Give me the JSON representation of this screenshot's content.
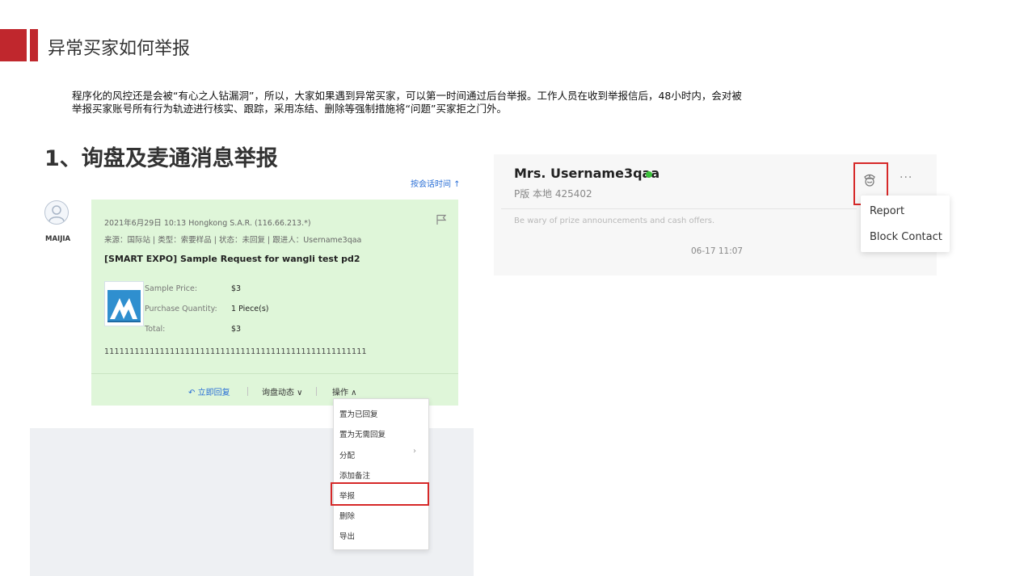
{
  "slide": {
    "title": "异常买家如何举报",
    "intro_line1": "程序化的风控还是会被“有心之人钻漏洞”，所以，大家如果遇到异常买家，可以第一时间通过后台举报。工作人员在收到举报信后，48小时内，会对被",
    "intro_line2": "举报买家账号所有行为轨迹进行核实、跟踪，采用冻结、删除等强制措施将“问题”买家拒之门外。",
    "section_title": "1、询盘及麦通消息举报",
    "accent_color": "#c0272d"
  },
  "inquiry": {
    "sort_label": "按会话时间 ↑",
    "buyer_name": "MAIJIA",
    "meta_line1": "2021年6月29日 10:13   Hongkong S.A.R. (116.66.213.*)",
    "meta_line2": "来源：国际站  |  类型：索要样品  |  状态：未回复  |  跟进人：Username3qaa",
    "subject": "[SMART EXPO] Sample Request for wangli test pd2",
    "product": {
      "rows": [
        {
          "label": "Sample Price:",
          "value": "$3"
        },
        {
          "label": "Purchase Quantity:",
          "value": "1 Piece(s)"
        },
        {
          "label": "Total:",
          "value": "$3"
        }
      ]
    },
    "message": "1111111111111111111111111111111111111111111111111111",
    "actions": {
      "reply": "立即回复",
      "dynamics": "询盘动态 ∨",
      "operate": "操作 ∧"
    },
    "menu_items": [
      "置为已回复",
      "置为无需回复",
      "分配",
      "添加备注",
      "举报",
      "删除",
      "导出"
    ],
    "highlight_color": "#d62828",
    "card_color": "#dff6d9"
  },
  "chat": {
    "contact_name": "Mrs. Username3qaa",
    "contact_sub": "P版 本地 425402",
    "warning": "Be wary of prize announcements and cash offers.",
    "timestamp": "06-17 11:07",
    "more_label": "···",
    "dropdown": [
      "Report",
      "Block Contact"
    ],
    "online_color": "#3cc13b"
  }
}
